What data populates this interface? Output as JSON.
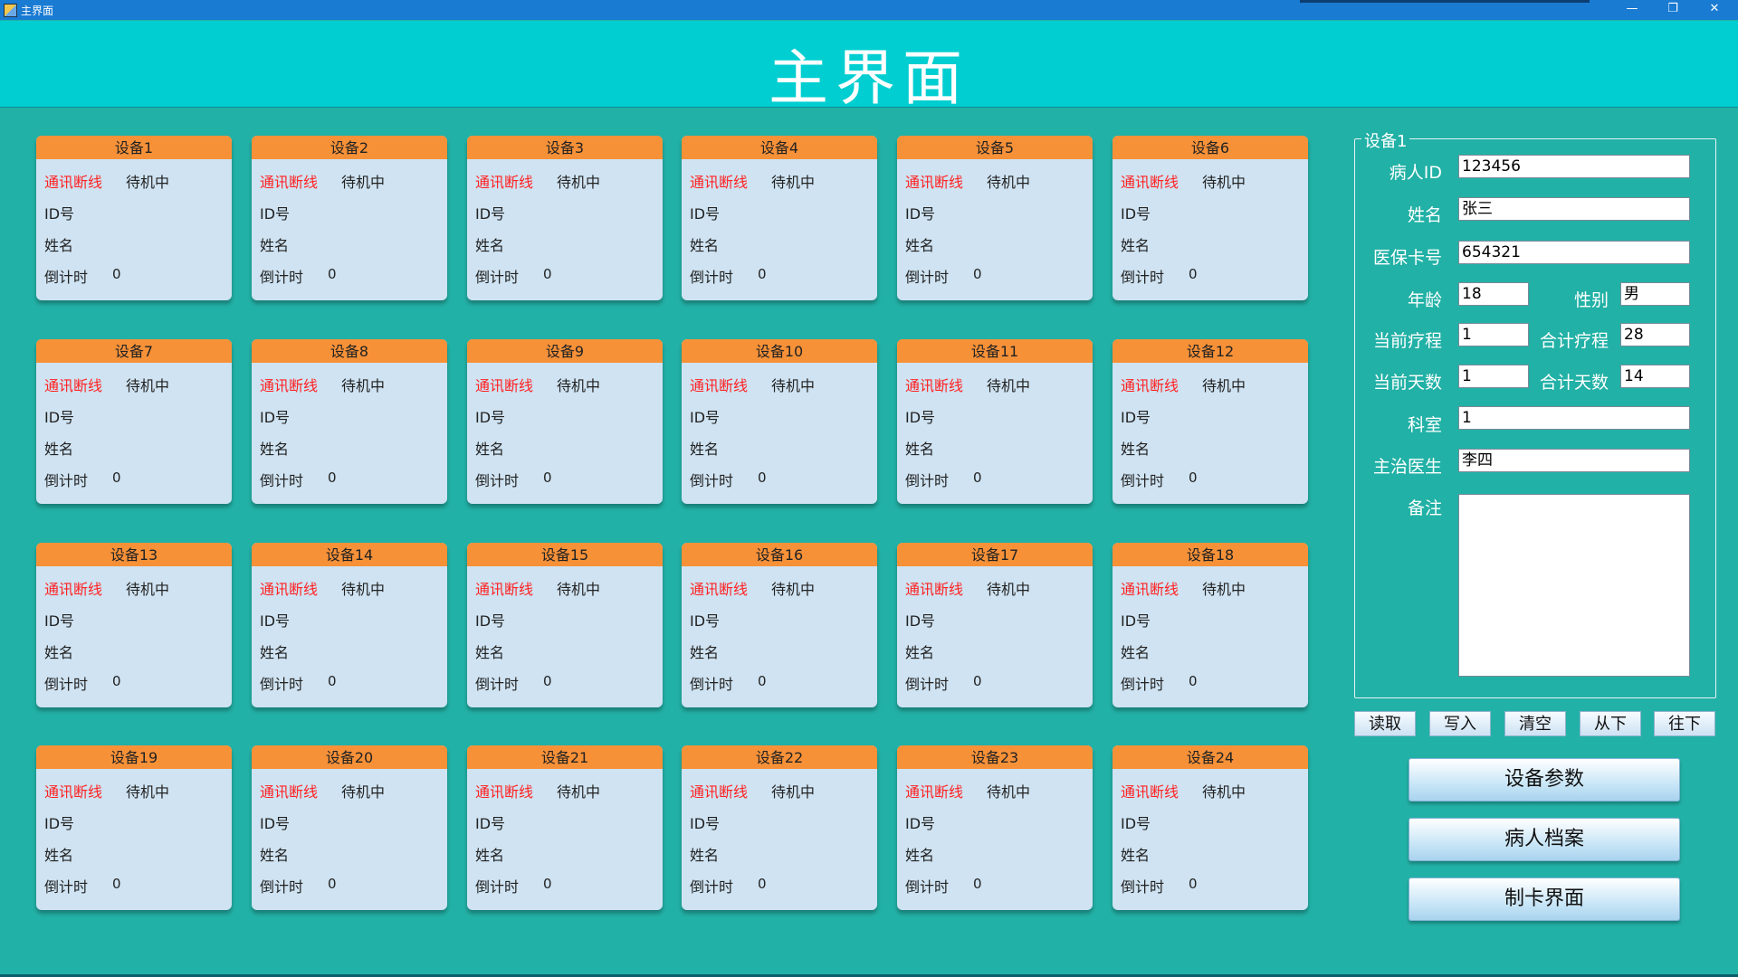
{
  "window": {
    "title": "主界面",
    "controls": {
      "minimize": "—",
      "restore": "❐",
      "close": "✕"
    }
  },
  "header": {
    "title": "主界面"
  },
  "device_labels": {
    "comm_status": "通讯断线",
    "run_status": "待机中",
    "id_label": "ID号",
    "name_label": "姓名",
    "countdown_label": "倒计时",
    "countdown_value": "0"
  },
  "devices": [
    {
      "name": "设备1"
    },
    {
      "name": "设备2"
    },
    {
      "name": "设备3"
    },
    {
      "name": "设备4"
    },
    {
      "name": "设备5"
    },
    {
      "name": "设备6"
    },
    {
      "name": "设备7"
    },
    {
      "name": "设备8"
    },
    {
      "name": "设备9"
    },
    {
      "name": "设备10"
    },
    {
      "name": "设备11"
    },
    {
      "name": "设备12"
    },
    {
      "name": "设备13"
    },
    {
      "name": "设备14"
    },
    {
      "name": "设备15"
    },
    {
      "name": "设备16"
    },
    {
      "name": "设备17"
    },
    {
      "name": "设备18"
    },
    {
      "name": "设备19"
    },
    {
      "name": "设备20"
    },
    {
      "name": "设备21"
    },
    {
      "name": "设备22"
    },
    {
      "name": "设备23"
    },
    {
      "name": "设备24"
    }
  ],
  "detail": {
    "group_title": "设备1",
    "patient_id": {
      "label": "病人ID",
      "value": "123456"
    },
    "name": {
      "label": "姓名",
      "value": "张三"
    },
    "insurance_no": {
      "label": "医保卡号",
      "value": "654321"
    },
    "age": {
      "label": "年龄",
      "value": "18"
    },
    "gender": {
      "label": "性别",
      "value": "男"
    },
    "current_course": {
      "label": "当前疗程",
      "value": "1"
    },
    "total_course": {
      "label": "合计疗程",
      "value": "28"
    },
    "current_days": {
      "label": "当前天数",
      "value": "1"
    },
    "total_days": {
      "label": "合计天数",
      "value": "14"
    },
    "department": {
      "label": "科室",
      "value": "1"
    },
    "doctor": {
      "label": "主治医生",
      "value": "李四"
    },
    "remark": {
      "label": "备注",
      "value": ""
    }
  },
  "actions": {
    "read": "读取",
    "write": "写入",
    "clear": "清空",
    "from_below": "从下",
    "go_down": "往下"
  },
  "nav": {
    "device_params": "设备参数",
    "patient_records": "病人档案",
    "card_making": "制卡界面"
  }
}
